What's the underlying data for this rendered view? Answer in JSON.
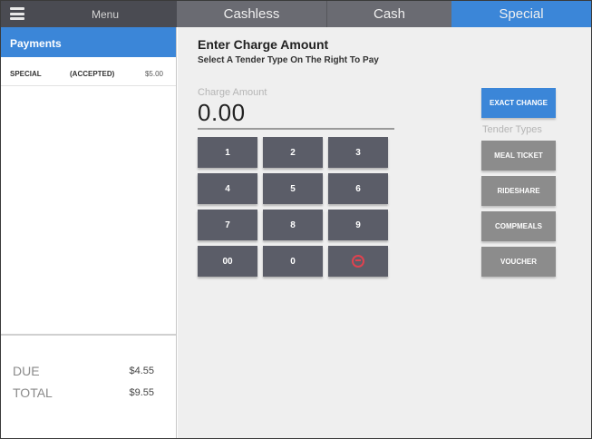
{
  "topbar": {
    "menu_label": "Menu",
    "tabs": [
      {
        "label": "Cashless"
      },
      {
        "label": "Cash"
      },
      {
        "label": "Special",
        "active": true
      }
    ]
  },
  "payments": {
    "header": "Payments",
    "items": [
      {
        "type": "SPECIAL",
        "status": "(ACCEPTED)",
        "amount": "$5.00"
      }
    ]
  },
  "totals": {
    "due_label": "DUE",
    "due_value": "$4.55",
    "total_label": "TOTAL",
    "total_value": "$9.55"
  },
  "charge": {
    "title": "Enter Charge Amount",
    "subtitle": "Select A Tender Type On The Right To Pay",
    "field_label": "Charge Amount",
    "value": "0.00"
  },
  "keypad": {
    "keys": [
      "1",
      "2",
      "3",
      "4",
      "5",
      "6",
      "7",
      "8",
      "9",
      "00",
      "0"
    ],
    "backspace_icon": "backspace-circle-icon"
  },
  "tender": {
    "exact_change": "EXACT CHANGE",
    "label": "Tender Types",
    "types": [
      "MEAL TICKET",
      "RIDESHARE",
      "COMPMEALS",
      "VOUCHER"
    ]
  },
  "colors": {
    "accent": "#3b86d8",
    "topbar_dark": "#4a4b52",
    "tab_gray": "#6a6b72",
    "key_bg": "#5b5d68",
    "tender_bg": "#8c8c8c",
    "backspace_red": "#e0424f"
  }
}
